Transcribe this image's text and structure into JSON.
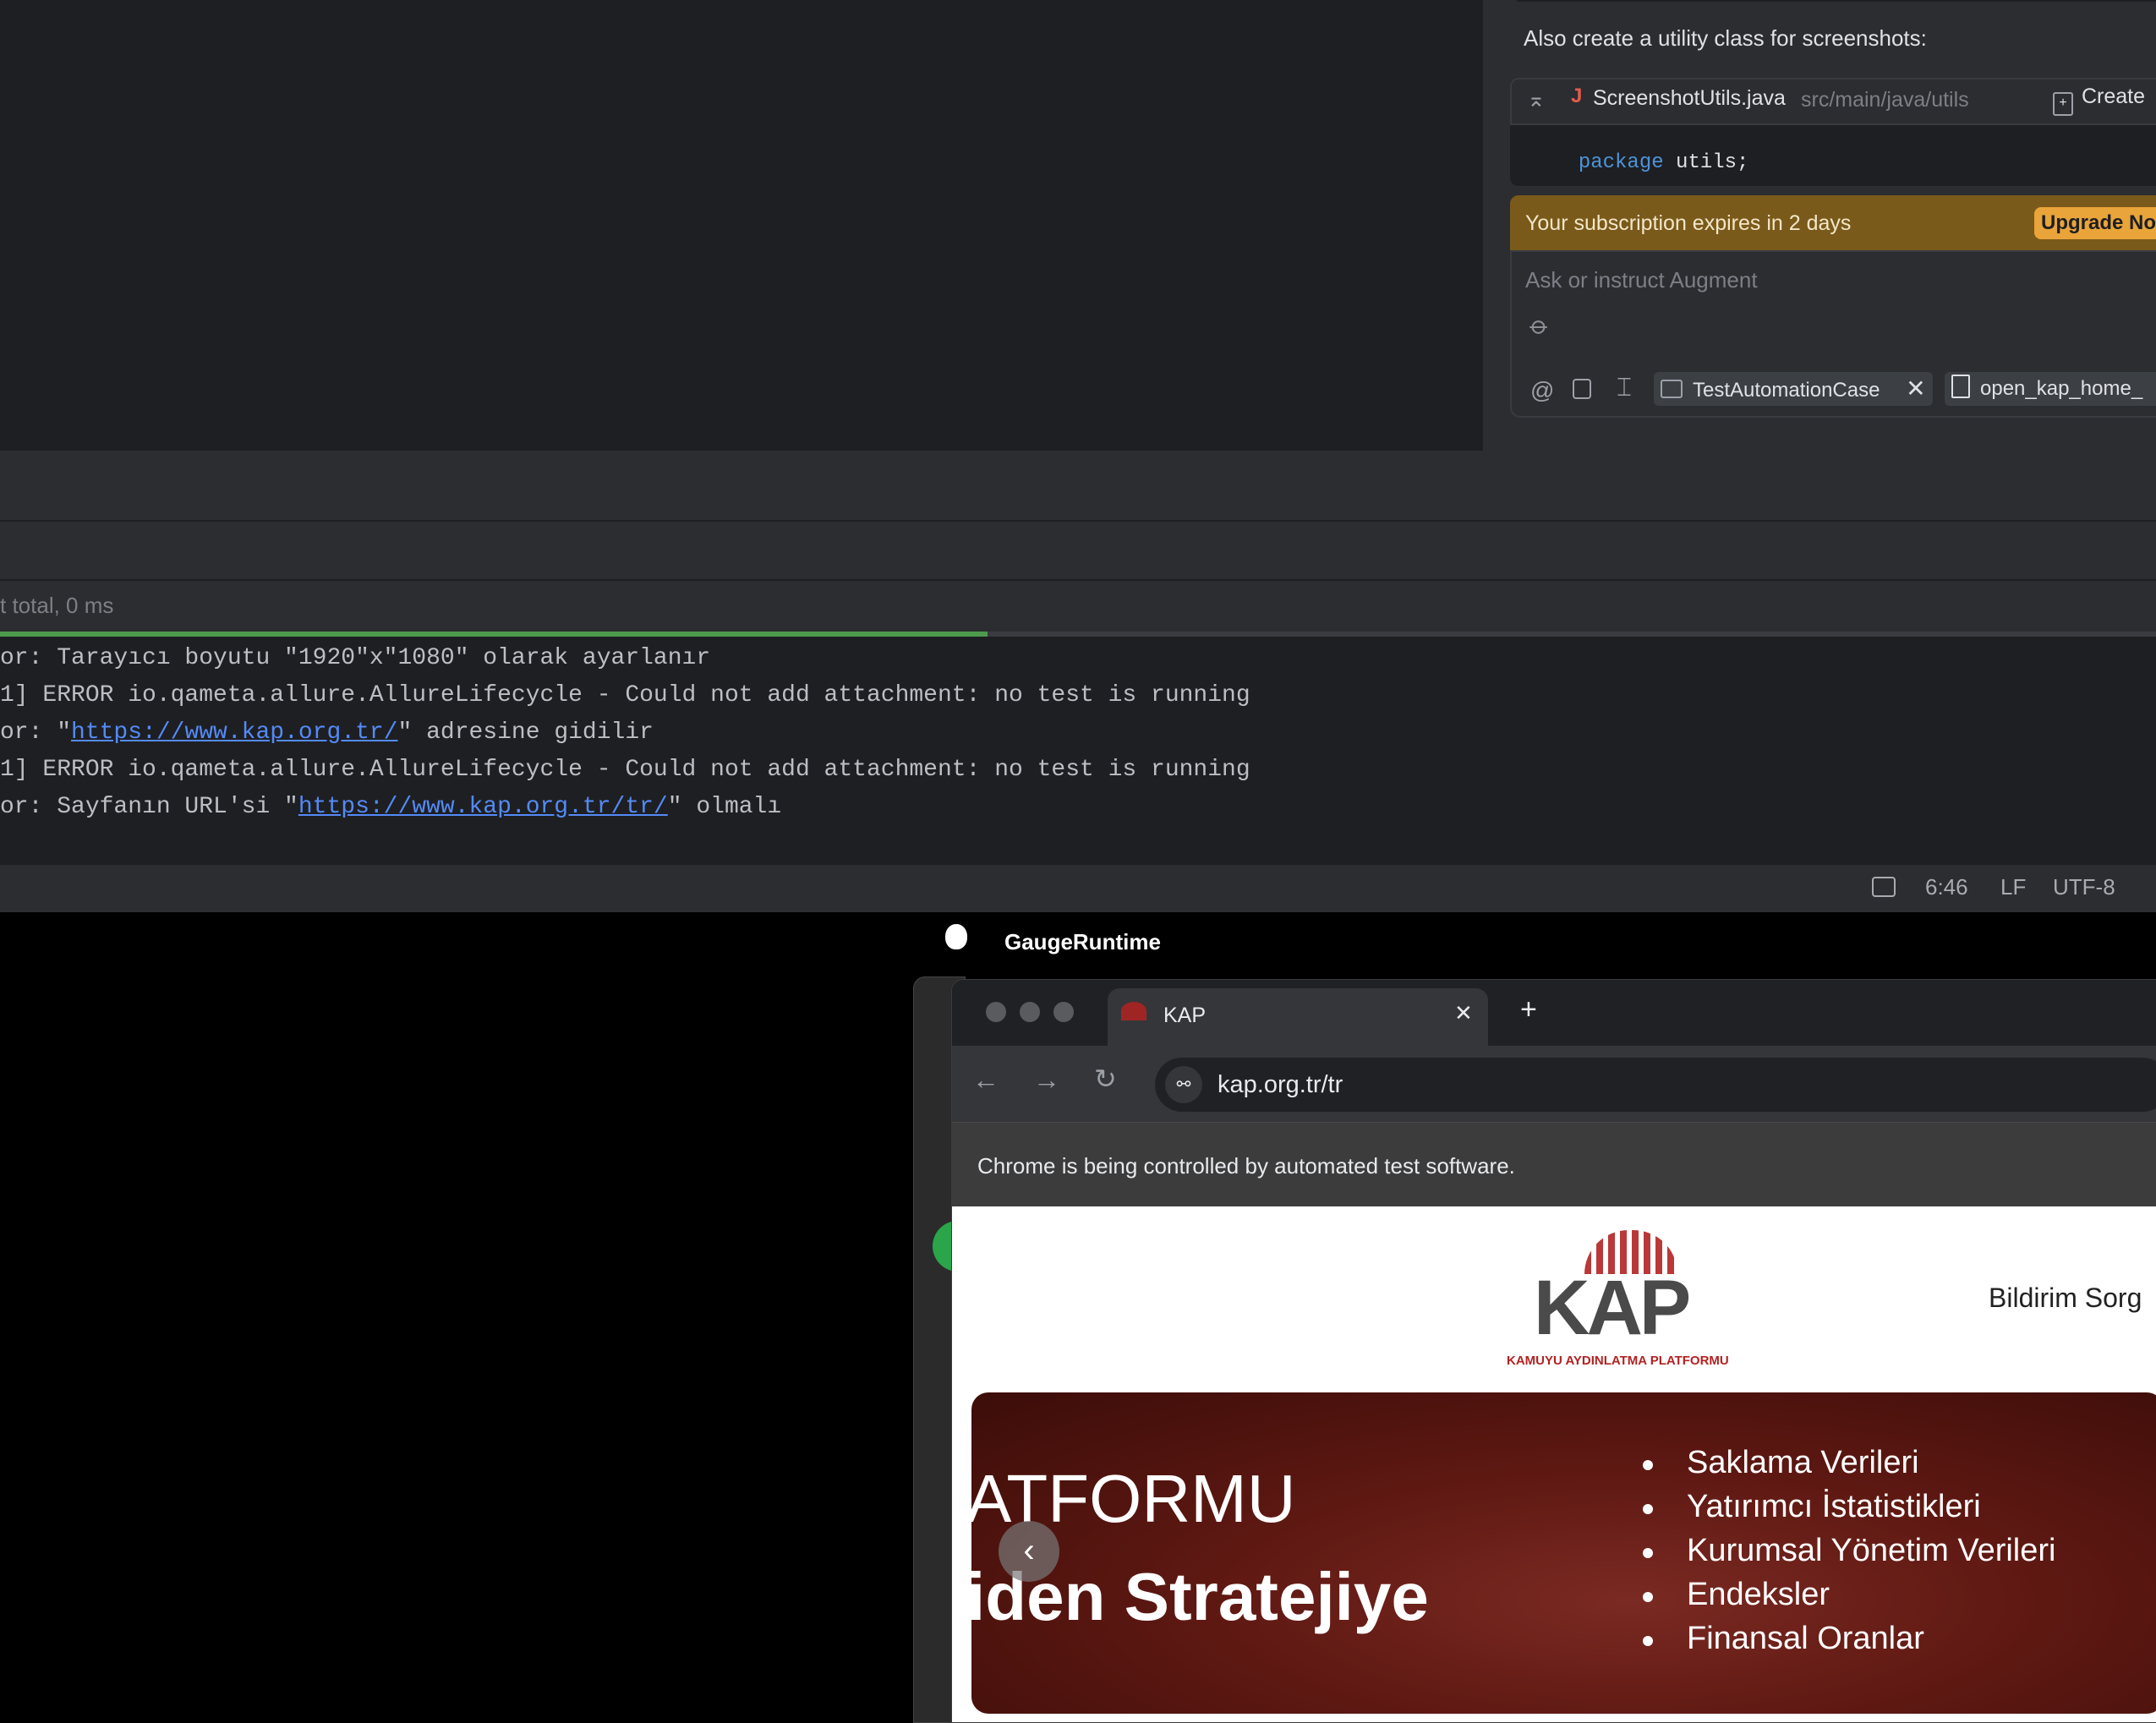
{
  "assistant": {
    "intro_text": "Also create a utility class for screenshots:",
    "file_name": "ScreenshotUtils.java",
    "file_path": "src/main/java/utils",
    "create_label": "Create",
    "code_keyword": "package",
    "code_rest": " utils;",
    "subscription_text": "Your subscription expires in 2 days",
    "upgrade_label": "Upgrade No",
    "input_placeholder": "Ask or instruct Augment",
    "context_chip_1": "TestAutomationCase",
    "context_chip_2": "open_kap_home_"
  },
  "run": {
    "summary": "t total, 0 ms",
    "progress_fraction": 0.458
  },
  "console": {
    "line1": "or: Tarayıcı boyutu \"1920\"x\"1080\" olarak ayarlanır",
    "line2": "1] ERROR io.qameta.allure.AllureLifecycle - Could not add attachment: no test is running",
    "line3_pre": "or: \"",
    "line3_link": "https://www.kap.org.tr/",
    "line3_post": "\" adresine gidilir",
    "line4": "1] ERROR io.qameta.allure.AllureLifecycle - Could not add attachment: no test is running",
    "line5_pre": "or: Sayfanın URL'si \"",
    "line5_link": "https://www.kap.org.tr/tr/",
    "line5_post": "\" olmalı"
  },
  "status_bar": {
    "position": "6:46",
    "line_ending": "LF",
    "encoding": "UTF-8"
  },
  "menubar": {
    "app_name": "GaugeRuntime"
  },
  "browser": {
    "tab_title": "KAP",
    "url": "kap.org.tr/tr",
    "infobar_text": "Chrome is being controlled by automated test software.",
    "nav_link": "Bildirim Sorg",
    "logo_text": "KAP",
    "logo_subtitle": "KAMUYU AYDINLATMA PLATFORMU",
    "hero_title_1": "ATFORMU",
    "hero_title_2": "iden Stratejiye",
    "hero_items": [
      "Saklama Verileri",
      "Yatırımcı İstatistikleri",
      "Kurumsal Yönetim Verileri",
      "Endeksler",
      "Finansal Oranlar"
    ]
  },
  "colors": {
    "ide_bg": "#1e1f22",
    "panel_bg": "#2b2d30",
    "link": "#548af7",
    "progress": "#4e9a4d",
    "banner": "#7a5a1a",
    "kap_red": "#b22222"
  }
}
